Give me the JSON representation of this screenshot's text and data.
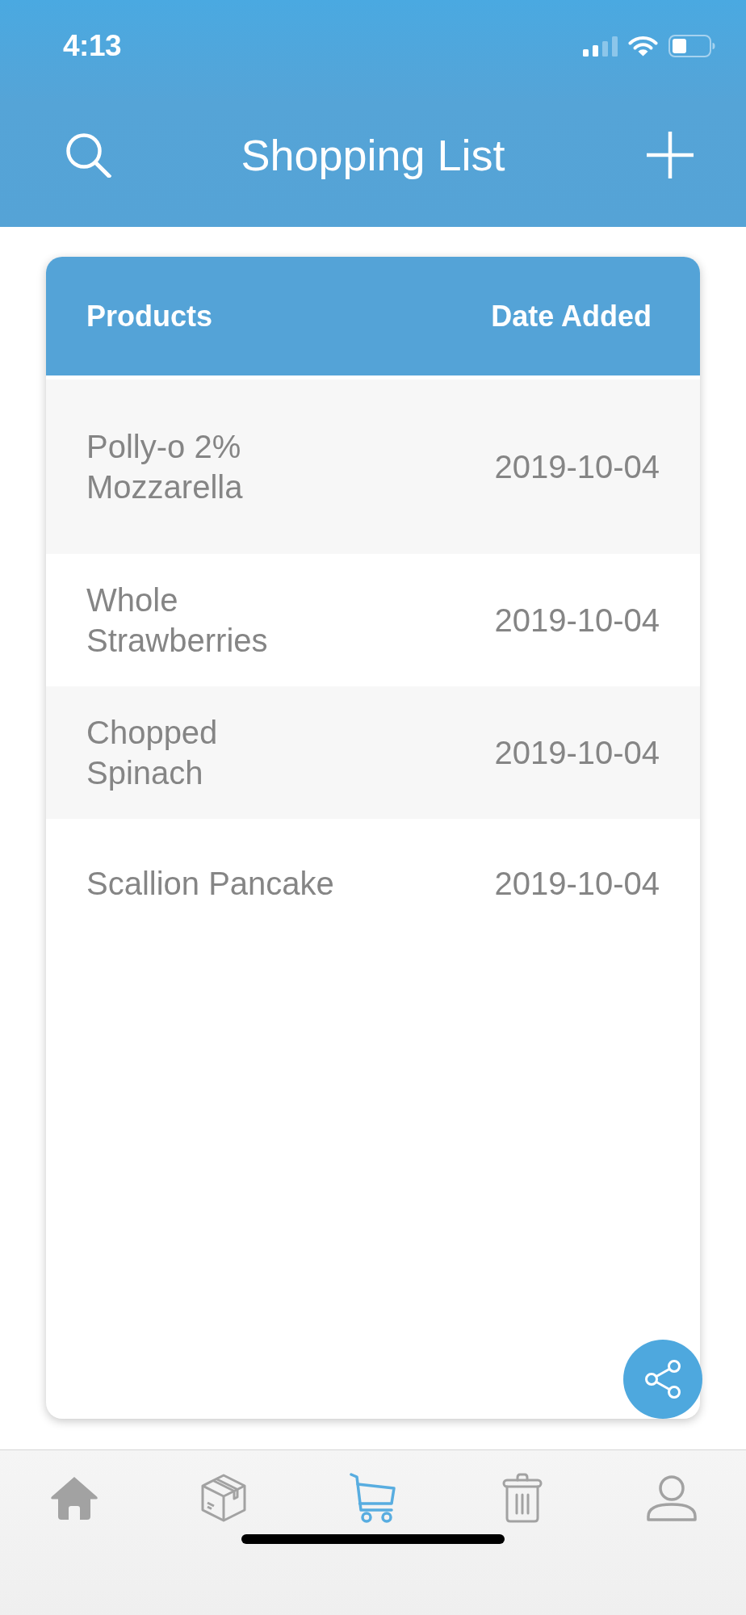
{
  "status_bar": {
    "time": "4:13"
  },
  "header": {
    "title": "Shopping List"
  },
  "table": {
    "columns": [
      "Products",
      "Date Added"
    ],
    "rows": [
      {
        "product": "Polly-o 2% Mozzarella",
        "date_added": "2019-10-04"
      },
      {
        "product": "Whole Strawberries",
        "date_added": "2019-10-04"
      },
      {
        "product": "Chopped Spinach",
        "date_added": "2019-10-04"
      },
      {
        "product": "Scallion Pancake",
        "date_added": "2019-10-04"
      }
    ]
  },
  "tab_bar": {
    "tabs": [
      {
        "selected": false
      },
      {
        "selected": false
      },
      {
        "selected": true
      },
      {
        "selected": false
      },
      {
        "selected": false
      }
    ]
  }
}
